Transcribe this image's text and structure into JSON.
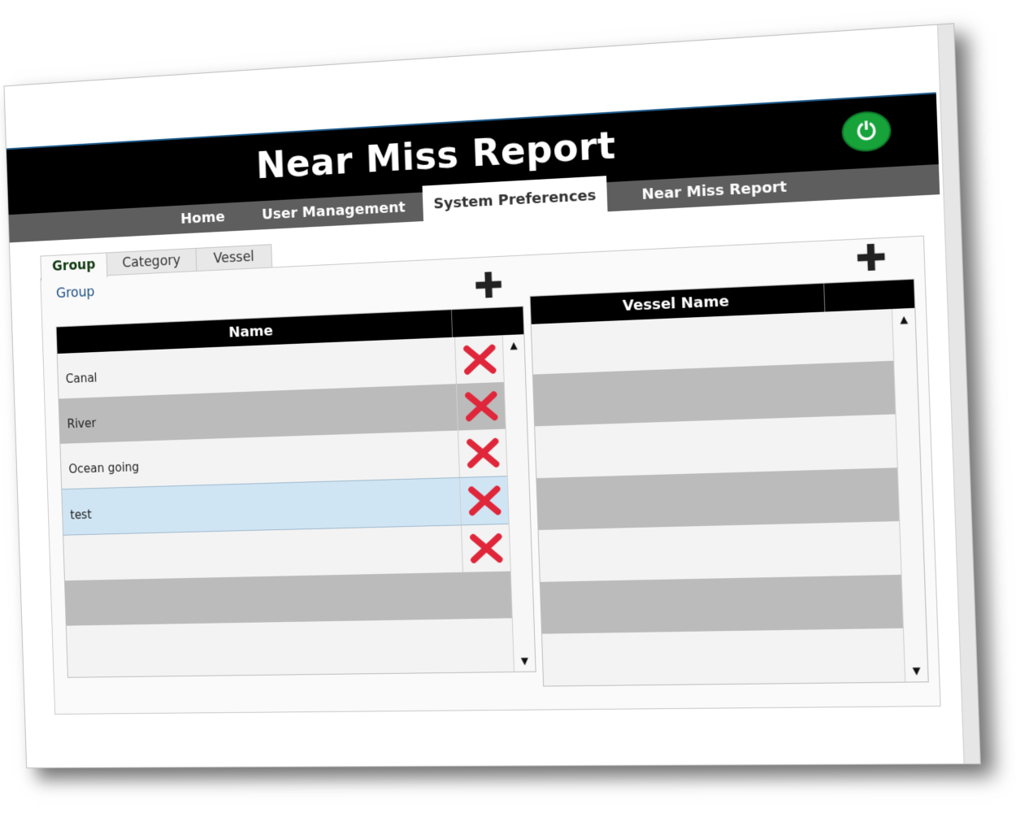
{
  "app": {
    "title": "Near Miss Report",
    "power_icon": "power-icon"
  },
  "nav": {
    "tabs": [
      {
        "label": "Home"
      },
      {
        "label": "User Management"
      },
      {
        "label": "System Preferences",
        "active": true
      },
      {
        "label": "Near Miss Report"
      }
    ]
  },
  "subtabs": [
    {
      "label": "Group",
      "active": true
    },
    {
      "label": "Category"
    },
    {
      "label": "Vessel"
    }
  ],
  "group_panel": {
    "label": "Group",
    "add_icon": "plus-icon",
    "columns": [
      "Name",
      ""
    ],
    "rows": [
      {
        "name": "Canal"
      },
      {
        "name": "River"
      },
      {
        "name": "Ocean going"
      },
      {
        "name": "test",
        "selected": true
      },
      {
        "name": ""
      }
    ],
    "delete_icon": "delete-x-icon"
  },
  "vessel_panel": {
    "add_icon": "plus-icon",
    "columns": [
      "Vessel Name",
      ""
    ]
  },
  "colors": {
    "header": "#000000",
    "navbar": "#5e5e5e",
    "power": "#17a33a",
    "delete": "#e0263a",
    "selected_row": "#cfe5f4"
  }
}
